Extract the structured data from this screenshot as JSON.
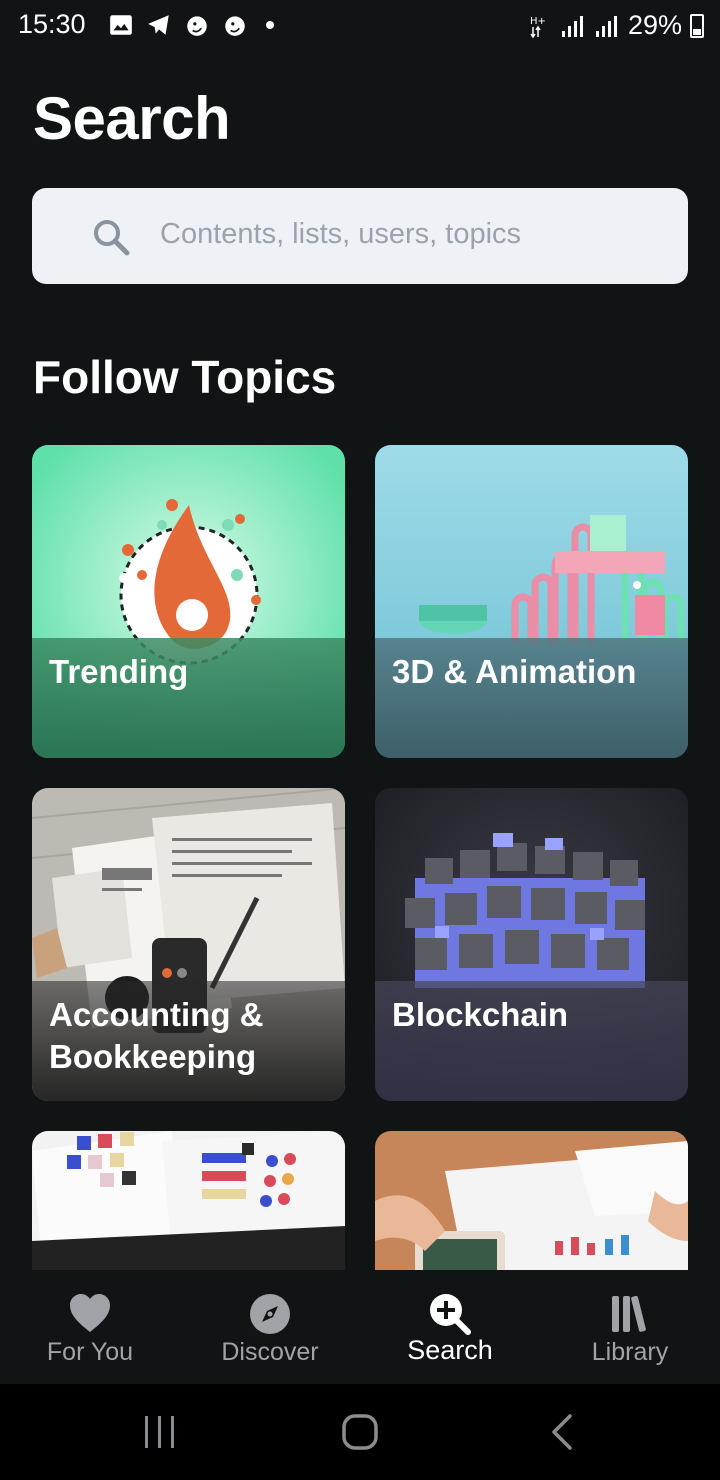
{
  "status_bar": {
    "time": "15:30",
    "battery": "29%",
    "icons": [
      "image-icon",
      "telegram-icon",
      "lion-icon",
      "lion-icon",
      "notification-dot",
      "data-arrows-icon",
      "signal-icon",
      "signal-icon",
      "battery-icon"
    ]
  },
  "page": {
    "title": "Search"
  },
  "search": {
    "placeholder": "Contents, lists, users, topics"
  },
  "topics": {
    "title": "Follow Topics",
    "items": [
      {
        "label": "Trending",
        "color": "#5fe0a9"
      },
      {
        "label": "3D & Animation",
        "color": "#8fd0e0"
      },
      {
        "label": "Accounting & Bookkeeping",
        "color": "#c9c6c0"
      },
      {
        "label": "Blockchain",
        "color": "#2b2c33"
      },
      {
        "label": "",
        "color": "#f2f2f2"
      },
      {
        "label": "",
        "color": "#c6865a"
      }
    ]
  },
  "bottom_nav": {
    "items": [
      {
        "label": "For You",
        "icon": "heart-icon"
      },
      {
        "label": "Discover",
        "icon": "compass-icon"
      },
      {
        "label": "Search",
        "icon": "search-plus-icon",
        "active": true
      },
      {
        "label": "Library",
        "icon": "library-icon"
      }
    ]
  },
  "colors": {
    "background": "#111415",
    "search_field": "#eef1f5",
    "inactive_nav": "#a0a4a8"
  }
}
